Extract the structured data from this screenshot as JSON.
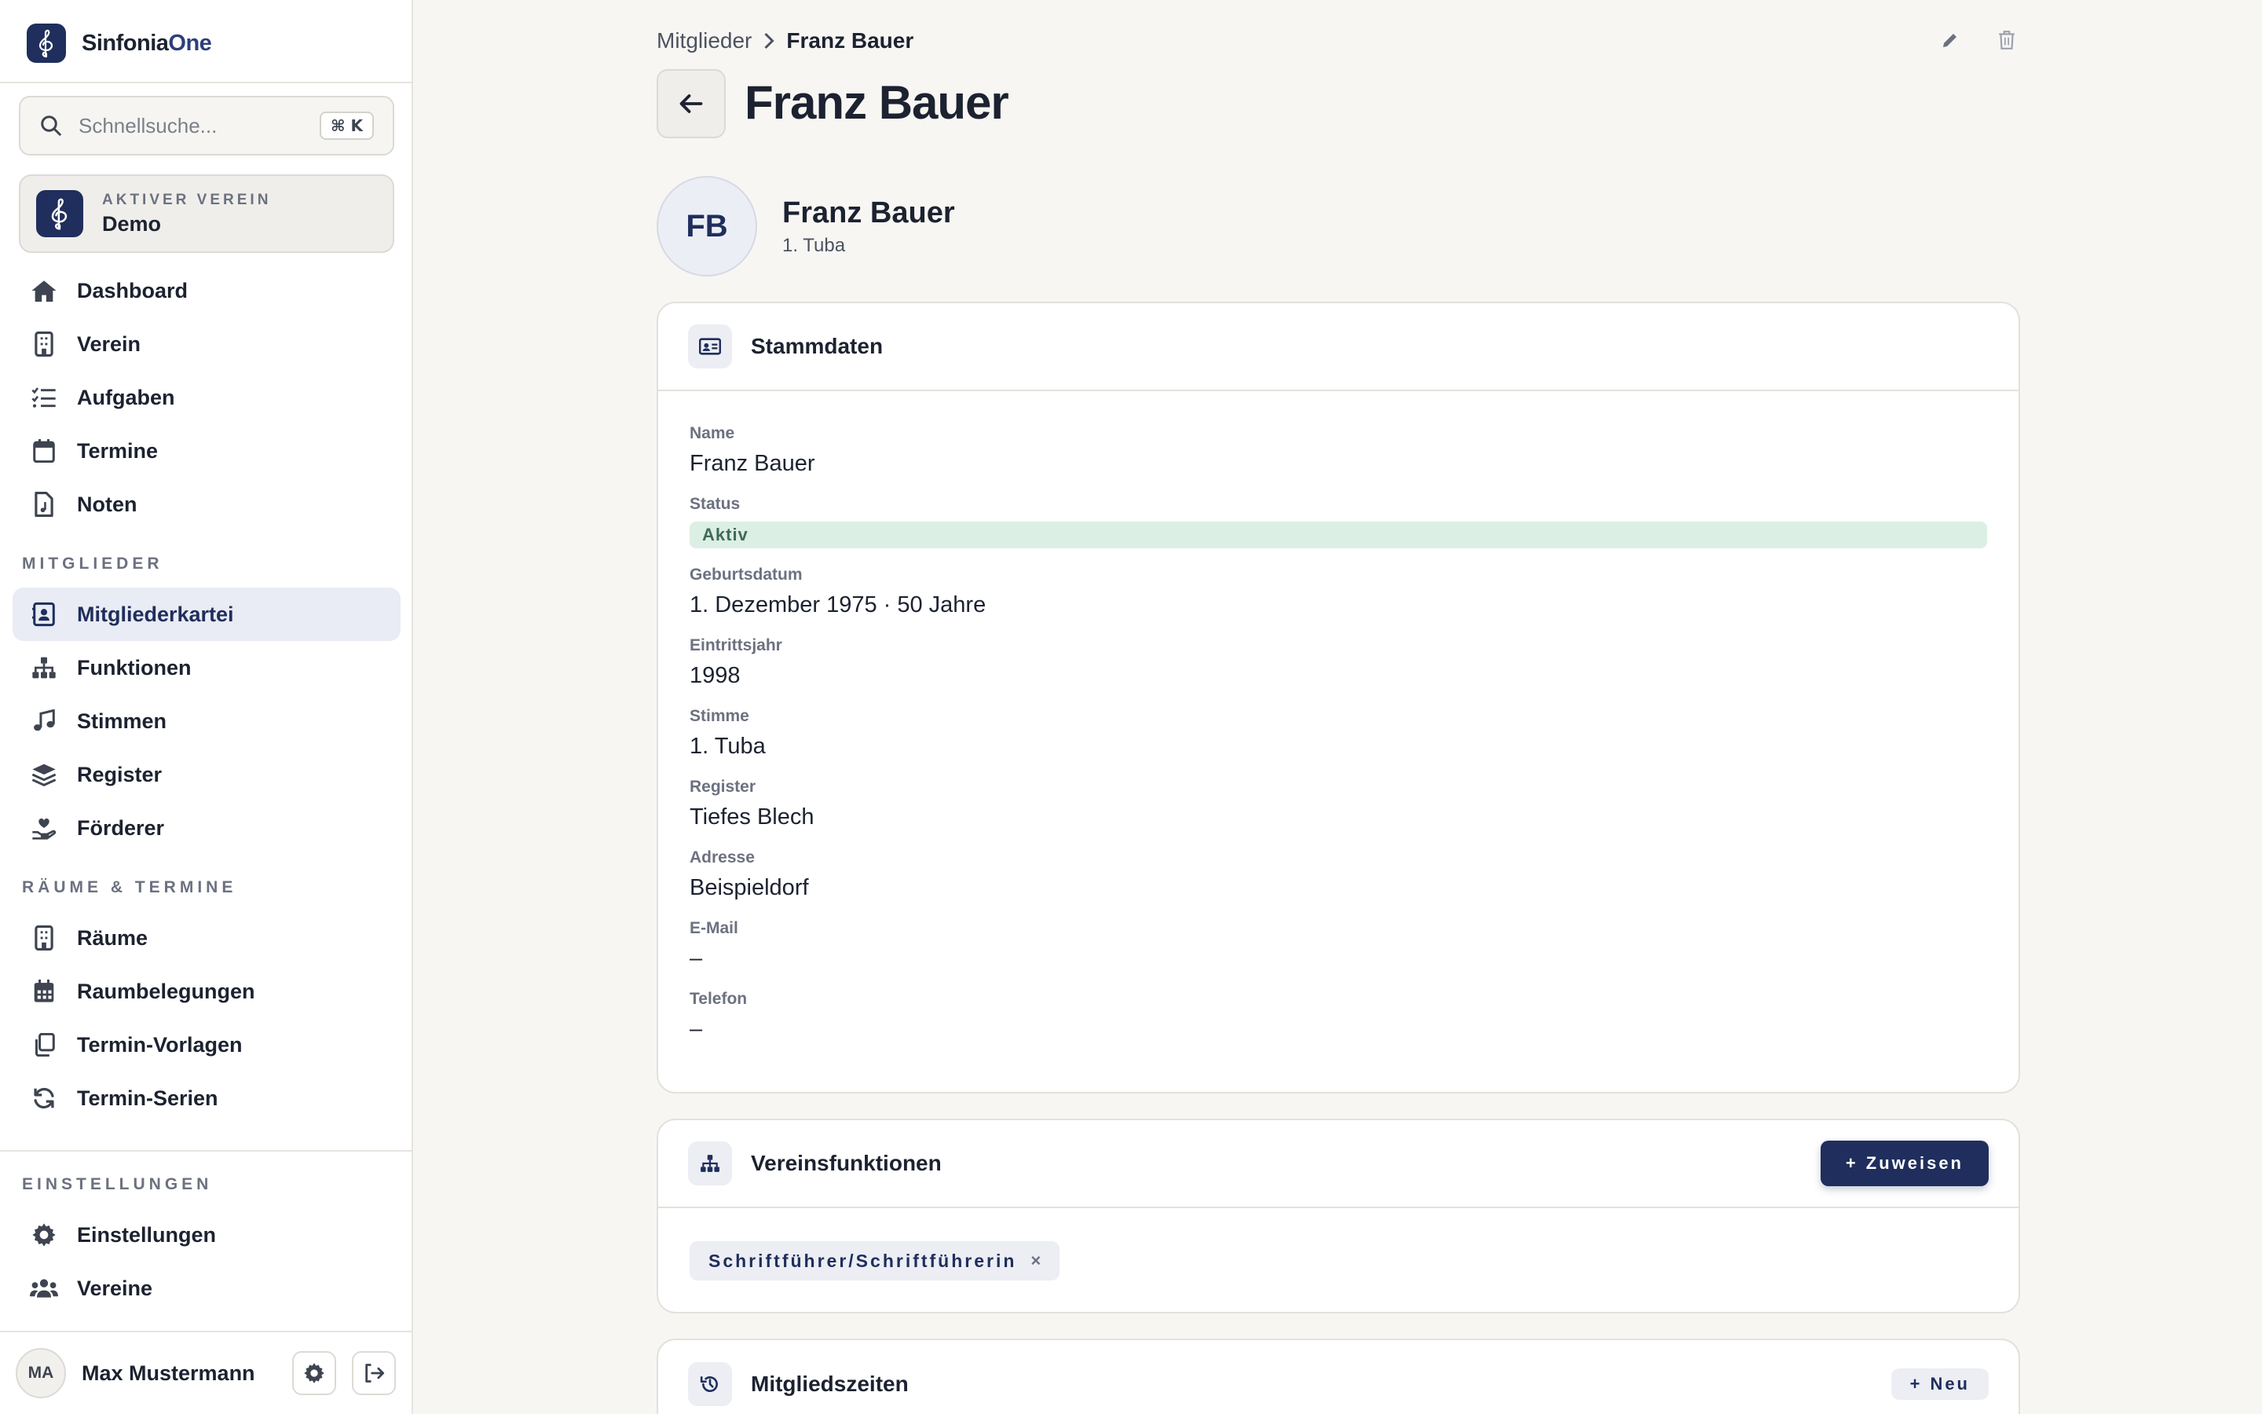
{
  "app": {
    "name_prefix": "Sinfonia",
    "name_suffix": "One"
  },
  "search": {
    "placeholder": "Schnellsuche...",
    "shortcut": "⌘ K"
  },
  "active_club": {
    "label": "AKTIVER VEREIN",
    "name": "Demo"
  },
  "nav": {
    "main": [
      {
        "label": "Dashboard",
        "icon": "home-icon"
      },
      {
        "label": "Verein",
        "icon": "building-icon"
      },
      {
        "label": "Aufgaben",
        "icon": "tasks-icon"
      },
      {
        "label": "Termine",
        "icon": "calendar-icon"
      },
      {
        "label": "Noten",
        "icon": "sheet-music-file-icon"
      }
    ],
    "section_members": "MITGLIEDER",
    "members": [
      {
        "label": "Mitgliederkartei",
        "icon": "address-book-icon",
        "active": true
      },
      {
        "label": "Funktionen",
        "icon": "sitemap-icon"
      },
      {
        "label": "Stimmen",
        "icon": "music-note-icon"
      },
      {
        "label": "Register",
        "icon": "layers-icon"
      },
      {
        "label": "Förderer",
        "icon": "hand-heart-icon"
      }
    ],
    "section_rooms": "RÄUME & TERMINE",
    "rooms": [
      {
        "label": "Räume",
        "icon": "building-icon"
      },
      {
        "label": "Raumbelegungen",
        "icon": "calendar-grid-icon"
      },
      {
        "label": "Termin-Vorlagen",
        "icon": "copy-icon"
      },
      {
        "label": "Termin-Serien",
        "icon": "refresh-icon"
      }
    ],
    "section_settings": "EINSTELLUNGEN",
    "settings": [
      {
        "label": "Einstellungen",
        "icon": "gear-icon"
      },
      {
        "label": "Vereine",
        "icon": "users-icon"
      }
    ]
  },
  "user": {
    "initials": "MA",
    "name": "Max Mustermann"
  },
  "breadcrumb": {
    "parent": "Mitglieder",
    "current": "Franz Bauer"
  },
  "page": {
    "title": "Franz Bauer"
  },
  "profile": {
    "initials": "FB",
    "name": "Franz Bauer",
    "subtitle": "1. Tuba"
  },
  "stammdaten": {
    "title": "Stammdaten",
    "fields": {
      "name": {
        "label": "Name",
        "value": "Franz Bauer"
      },
      "status": {
        "label": "Status",
        "value": "Aktiv"
      },
      "birth": {
        "label": "Geburtsdatum",
        "value": "1. Dezember 1975 · 50 Jahre"
      },
      "entry": {
        "label": "Eintrittsjahr",
        "value": "1998"
      },
      "voice": {
        "label": "Stimme",
        "value": "1. Tuba"
      },
      "register": {
        "label": "Register",
        "value": "Tiefes Blech"
      },
      "address": {
        "label": "Adresse",
        "value": "Beispieldorf"
      },
      "email": {
        "label": "E-Mail",
        "value": "–"
      },
      "phone": {
        "label": "Telefon",
        "value": "–"
      }
    }
  },
  "functions": {
    "title": "Vereinsfunktionen",
    "assign_label": "Zuweisen",
    "chip": "Schriftführer/Schriftführerin",
    "chip_remove": "×"
  },
  "memberships": {
    "title": "Mitgliedszeiten",
    "new_label": "Neu"
  },
  "colors": {
    "primary": "#1f2e5c",
    "status_bg": "#dcefe5",
    "status_text": "#3e6b57"
  }
}
